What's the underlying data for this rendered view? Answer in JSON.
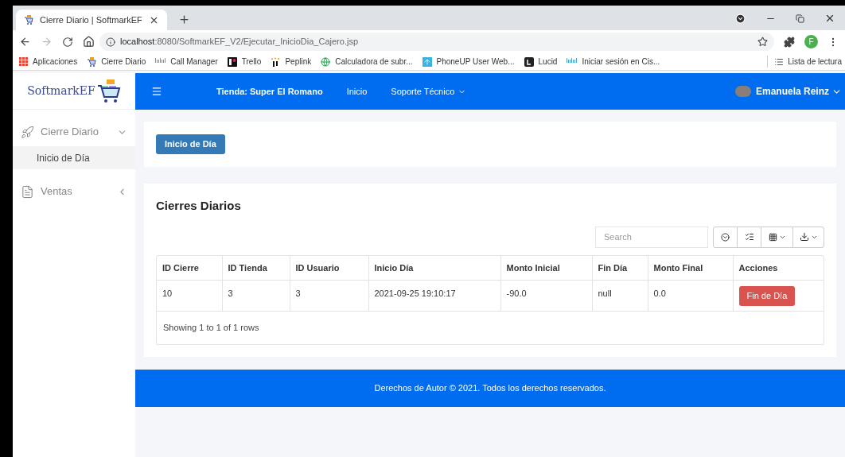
{
  "browser": {
    "tab": {
      "title": "Cierre Diario | SoftmarkEF"
    },
    "url": {
      "host": "localhost",
      "rest": ":8080/SoftmarkEF_V2/Ejecutar_InicioDia_Cajero.jsp"
    },
    "profile_initial": "F",
    "bookmarks": [
      {
        "label": "Aplicaciones",
        "kind": "apps"
      },
      {
        "label": "Cierre Diario",
        "kind": "cart"
      },
      {
        "label": "Call Manager",
        "kind": "cisco"
      },
      {
        "label": "Trello",
        "kind": "trello"
      },
      {
        "label": "Peplink",
        "kind": "peplink"
      },
      {
        "label": "Calculadora de subr...",
        "kind": "globe"
      },
      {
        "label": "PhoneUP User Web...",
        "kind": "arrow"
      },
      {
        "label": "Lucid",
        "kind": "lucid"
      },
      {
        "label": "Iniciar sesión en Cis...",
        "kind": "cisco"
      }
    ],
    "reading_list": "Lista de lectura"
  },
  "logo": "SoftmarkEF",
  "navbar": {
    "store": "Tienda: Super El Romano",
    "links": [
      {
        "label": "Inicio",
        "dropdown": false
      },
      {
        "label": "Soporte Técnico",
        "dropdown": true
      }
    ],
    "user": "Emanuela Reinz"
  },
  "sidebar": {
    "items": [
      {
        "label": "Cierre Diario",
        "kind": "rocket",
        "expanded": true,
        "children": [
          {
            "label": "Inicio de Día",
            "selected": true
          }
        ]
      },
      {
        "label": "Ventas",
        "kind": "document",
        "expanded": false
      }
    ]
  },
  "start_button": "Inicio de Día",
  "panel": {
    "title": "Cierres Diarios",
    "search": {
      "placeholder": "Search"
    },
    "table": {
      "columns": [
        "ID Cierre",
        "ID Tienda",
        "ID Usuario",
        "Inicio Día",
        "Monto Inicial",
        "Fin Día",
        "Monto Final",
        "Acciones"
      ],
      "rows": [
        {
          "cells": [
            "10",
            "3",
            "3",
            "2021-09-25 19:10:17",
            "-90.0",
            "null",
            "0.0"
          ],
          "action": "Fin de Día"
        }
      ]
    },
    "pagination": "Showing 1 to 1 of 1 rows"
  },
  "footer": "Derechos de Autor © 2021. Todos los derechos reservados."
}
